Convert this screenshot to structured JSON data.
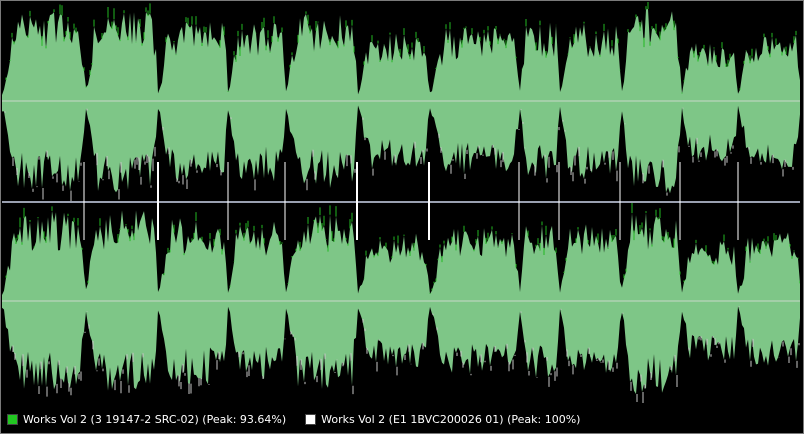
{
  "colors": {
    "background": "#000000",
    "divider": "#9aa0b0",
    "center_line": "#c8d8c8",
    "track_separator": "#ffffff"
  },
  "legend": [
    {
      "label": "Works Vol 2 (3 19147-2 SRC-02) (Peak: 93.64%)",
      "swatch_color": "#22c722",
      "fill_color": "#7ec687",
      "edge_color": "#22b822"
    },
    {
      "label": "Works Vol 2 (E1 1BVC200026 01) (Peak: 100%)",
      "swatch_color": "#ffffff",
      "fill_color": "#7ec687",
      "edge_color": "#c9c9c9"
    }
  ],
  "chart_data": {
    "type": "area",
    "title": "",
    "xlabel": "",
    "ylabel": "",
    "channels": [
      "top",
      "bottom"
    ],
    "ylim": [
      -1,
      1
    ],
    "grid": false,
    "legend_position": "bottom-left",
    "track_boundaries": [
      0.103,
      0.195,
      0.283,
      0.355,
      0.445,
      0.535,
      0.648,
      0.698,
      0.775,
      0.85,
      0.922
    ],
    "segment_peaks": [
      0.92,
      0.95,
      0.85,
      0.82,
      0.9,
      0.7,
      0.75,
      0.8,
      0.8,
      0.95,
      0.62,
      0.7
    ],
    "peak": {
      "series_1": 93.64,
      "series_2": 100
    }
  }
}
